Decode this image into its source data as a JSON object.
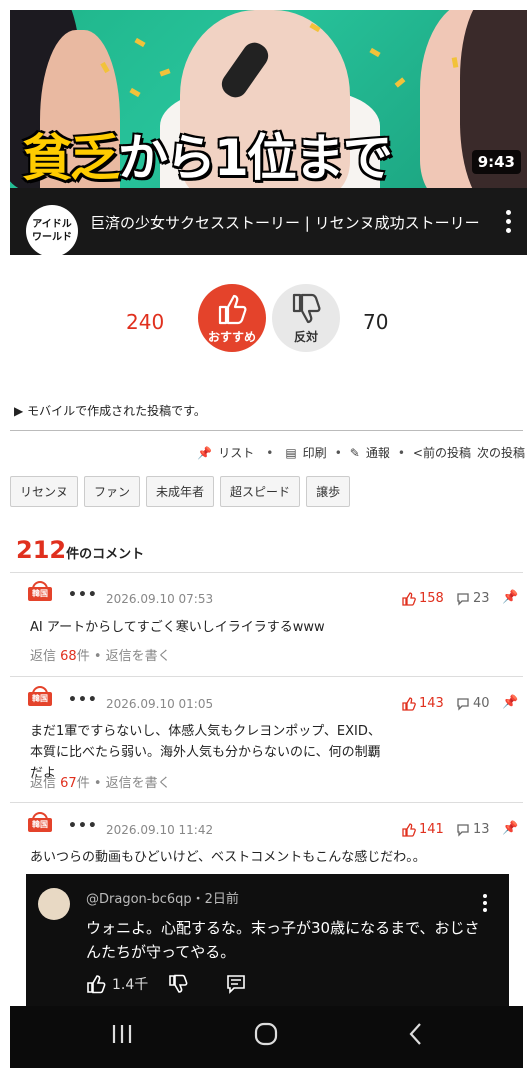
{
  "video": {
    "headline_yellow": "貧乏",
    "headline_white": "から1位まで",
    "duration": "9:43",
    "channel_avatar": "アイドル\nワールド",
    "title": "巨済の少女サクセスストーリー | リセンヌ成功ストーリー"
  },
  "vote": {
    "up_count": "240",
    "up_label": "おすすめ",
    "down_label": "反対",
    "down_count": "70"
  },
  "mobile_note": "モバイルで作成された投稿です。",
  "toolbar": {
    "list": "リスト",
    "print": "印刷",
    "report": "通報",
    "prev": "<前の投稿",
    "next": "次の投稿"
  },
  "tags": [
    "リセンヌ",
    "ファン",
    "未成年者",
    "超スピード",
    "譲歩"
  ],
  "comments_count": {
    "number": "212",
    "label": "件のコメント"
  },
  "comments": [
    {
      "badge": "韓国",
      "date": "2026.09.10 07:53",
      "likes": "158",
      "replies": "23",
      "text": "AI アートからしてすごく寒いしイライラするwww",
      "reply_prefix": "返信",
      "reply_count": "68",
      "reply_suffix": "件",
      "write_reply": "返信を書く"
    },
    {
      "badge": "韓国",
      "date": "2026.09.10 01:05",
      "likes": "143",
      "replies": "40",
      "text": "まだ1軍ですらないし、体感人気もクレヨンポップ、EXID、本質に比べたら弱い。海外人気も分からないのに、何の制覇だよ",
      "reply_prefix": "返信",
      "reply_count": "67",
      "reply_suffix": "件",
      "write_reply": "返信を書く"
    },
    {
      "badge": "韓国",
      "date": "2026.09.10 11:42",
      "likes": "141",
      "replies": "13",
      "text": "あいつらの動画もひどいけど、ベストコメントもこんな感じだわ。。"
    }
  ],
  "yt_comment": {
    "handle": "@Dragon-bc6qp",
    "time": "・2日前",
    "text": "ウォニよ。心配するな。末っ子が30歳になるまで、おじさんたちが守ってやる。",
    "likes": "1.4千"
  },
  "colors": {
    "accent": "#e4432b",
    "red_text": "#e0301e"
  }
}
